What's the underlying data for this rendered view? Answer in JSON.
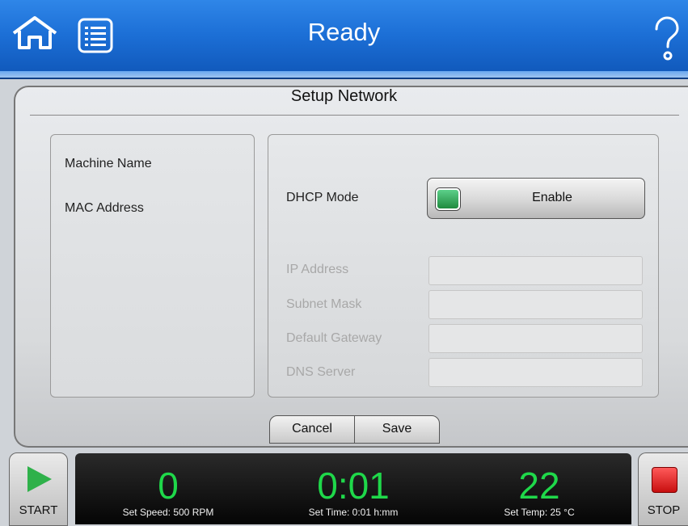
{
  "header": {
    "status": "Ready"
  },
  "icons": {
    "home": "home-icon",
    "menu": "list-menu-icon",
    "help": "help-icon"
  },
  "panel": {
    "title": "Setup Network",
    "left": {
      "machine_name_label": "Machine Name",
      "mac_address_label": "MAC Address"
    },
    "right": {
      "dhcp_label": "DHCP Mode",
      "dhcp_button": "Enable",
      "fields": [
        {
          "label": "IP Address",
          "value": ""
        },
        {
          "label": "Subnet Mask",
          "value": ""
        },
        {
          "label": "Default Gateway",
          "value": ""
        },
        {
          "label": "DNS Server",
          "value": ""
        }
      ]
    },
    "buttons": {
      "cancel": "Cancel",
      "save": "Save"
    }
  },
  "footer": {
    "start_label": "START",
    "stop_label": "STOP",
    "speed": {
      "value": "0",
      "setpoint": "Set Speed: 500 RPM"
    },
    "time": {
      "value": "0:01",
      "setpoint": "Set Time: 0:01 h:mm"
    },
    "temp": {
      "value": "22",
      "setpoint": "Set Temp: 25 °C"
    }
  },
  "colors": {
    "topbar": "#1c6fd6",
    "readout": "#1fd84a",
    "led": "#2fb14a",
    "stop": "#e01e1e"
  }
}
